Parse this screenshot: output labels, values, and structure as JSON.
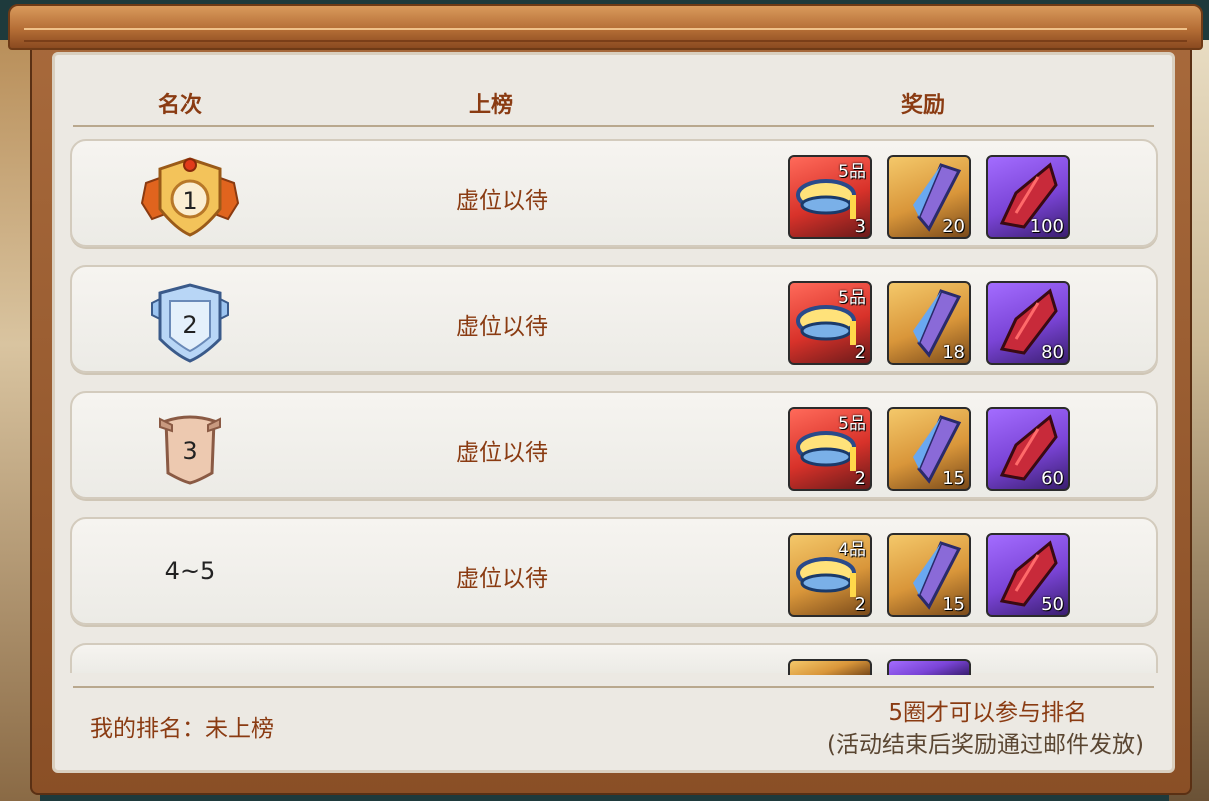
{
  "header": {
    "rank": "名次",
    "name": "上榜",
    "reward": "奖励"
  },
  "rows": [
    {
      "rank": "1",
      "name": "虚位以待",
      "items": [
        {
          "kind": "bowl",
          "bg": "red",
          "grade": "5品",
          "count": "3"
        },
        {
          "kind": "crystal",
          "bg": "gold",
          "count": "20"
        },
        {
          "kind": "shard",
          "bg": "purple",
          "count": "100"
        }
      ]
    },
    {
      "rank": "2",
      "name": "虚位以待",
      "items": [
        {
          "kind": "bowl",
          "bg": "red",
          "grade": "5品",
          "count": "2"
        },
        {
          "kind": "crystal",
          "bg": "gold",
          "count": "18"
        },
        {
          "kind": "shard",
          "bg": "purple",
          "count": "80"
        }
      ]
    },
    {
      "rank": "3",
      "name": "虚位以待",
      "items": [
        {
          "kind": "bowl",
          "bg": "red",
          "grade": "5品",
          "count": "2"
        },
        {
          "kind": "crystal",
          "bg": "gold",
          "count": "15"
        },
        {
          "kind": "shard",
          "bg": "purple",
          "count": "60"
        }
      ]
    },
    {
      "rank": "4~5",
      "name": "虚位以待",
      "items": [
        {
          "kind": "bowl",
          "bg": "gold",
          "grade": "4品",
          "count": "2"
        },
        {
          "kind": "crystal",
          "bg": "gold",
          "count": "15"
        },
        {
          "kind": "shard",
          "bg": "purple",
          "count": "50"
        }
      ]
    }
  ],
  "footer": {
    "my_rank": "我的排名：未上榜",
    "requirement": "5圈才可以参与排名",
    "note": "(活动结束后奖励通过邮件发放)"
  },
  "colors": {
    "title": "#8a3b12",
    "frame": "#a86a3c",
    "panel": "#ece9e3"
  },
  "icons": [
    "rank-1-badge-icon",
    "rank-2-badge-icon",
    "rank-3-badge-icon",
    "bowl-icon",
    "crystal-icon",
    "shard-icon"
  ]
}
